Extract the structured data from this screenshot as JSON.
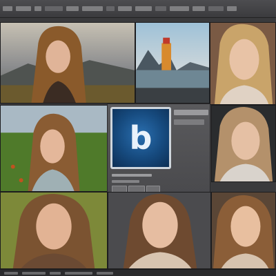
{
  "app": {
    "logo_letter": "b",
    "accent": "#164a7e"
  },
  "menu": {
    "items": [
      "",
      "",
      "",
      "",
      "",
      "",
      "",
      "",
      "",
      "",
      "",
      ""
    ]
  },
  "photos": [
    "portrait-woman-field-sunset",
    "lighthouse-landscape",
    "portrait-woman-blonde",
    "portrait-woman-meadow",
    "portrait-woman-wavy-hair",
    "portrait-woman-autumn",
    "portrait-woman-brunette",
    "portrait-woman-smile"
  ]
}
